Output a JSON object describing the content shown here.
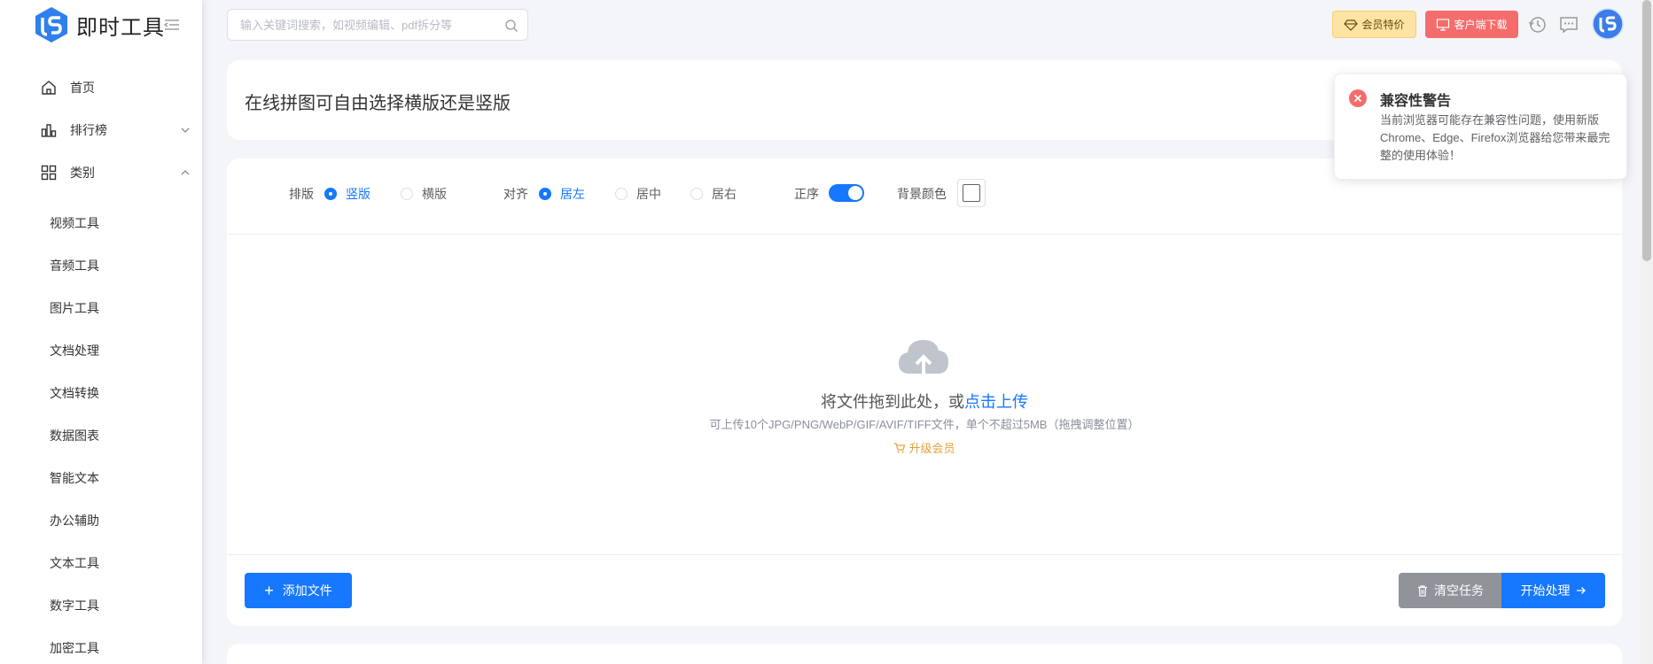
{
  "app": {
    "logo_text": "即时工具"
  },
  "sidebar": {
    "items": [
      {
        "label": "首页"
      },
      {
        "label": "排行榜"
      },
      {
        "label": "类别"
      }
    ],
    "sub_items": [
      {
        "label": "视频工具"
      },
      {
        "label": "音频工具"
      },
      {
        "label": "图片工具"
      },
      {
        "label": "文档处理"
      },
      {
        "label": "文档转换"
      },
      {
        "label": "数据图表"
      },
      {
        "label": "智能文本"
      },
      {
        "label": "办公辅助"
      },
      {
        "label": "文本工具"
      },
      {
        "label": "数字工具"
      },
      {
        "label": "加密工具"
      }
    ]
  },
  "header": {
    "search_placeholder": "输入关键词搜索，如视频编辑、pdf拆分等",
    "vip_label": "会员特价",
    "client_label": "客户端下载"
  },
  "page": {
    "title": "在线拼图可自由选择横版还是竖版"
  },
  "options": {
    "layout_label": "排版",
    "layout_vertical": "竖版",
    "layout_horizontal": "横版",
    "layout_selected": "竖版",
    "align_label": "对齐",
    "align_left": "居左",
    "align_center": "居中",
    "align_right": "居右",
    "align_selected": "居左",
    "order_label": "正序",
    "order_on": true,
    "bg_label": "背景颜色",
    "bg_color": "#ffffff"
  },
  "upload": {
    "main_text": "将文件拖到此处，或",
    "link_text": "点击上传",
    "sub_text": "可上传10个JPG/PNG/WebP/GIF/AVIF/TIFF文件，单个不超过5MB（拖拽调整位置）",
    "upgrade_text": "升级会员"
  },
  "actions": {
    "add_label": "添加文件",
    "clear_label": "清空任务",
    "start_label": "开始处理"
  },
  "notice": {
    "title": "兼容性警告",
    "body": "当前浏览器可能存在兼容性问题，使用新版Chrome、Edge、Firefox浏览器给您带来最完整的使用体验！"
  },
  "colors": {
    "primary": "#1677ff",
    "danger": "#f56c6c",
    "vip_bg": "#fde3a4",
    "gray_button": "#909399",
    "upgrade": "#e6a23c"
  }
}
